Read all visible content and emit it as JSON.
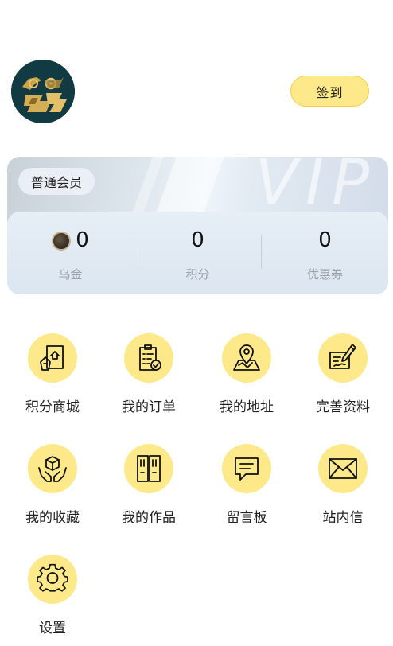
{
  "header": {
    "avatar_icon": "user-avatar-logo",
    "signin_label": "签到"
  },
  "vip_card": {
    "watermark": "VIP",
    "member_level": "普通会员",
    "stats": [
      {
        "value": "0",
        "label": "乌金",
        "icon": "coin-icon"
      },
      {
        "value": "0",
        "label": "积分"
      },
      {
        "value": "0",
        "label": "优惠券"
      }
    ]
  },
  "menu": {
    "items": [
      {
        "label": "积分商城",
        "icon": "points-mall-icon"
      },
      {
        "label": "我的订单",
        "icon": "orders-clipboard-icon"
      },
      {
        "label": "我的地址",
        "icon": "map-pin-icon"
      },
      {
        "label": "完善资料",
        "icon": "edit-profile-icon"
      },
      {
        "label": "我的收藏",
        "icon": "collection-hands-icon"
      },
      {
        "label": "我的作品",
        "icon": "works-book-icon"
      },
      {
        "label": "留言板",
        "icon": "message-board-icon"
      },
      {
        "label": "站内信",
        "icon": "mail-envelope-icon"
      },
      {
        "label": "设置",
        "icon": "gear-icon"
      }
    ]
  },
  "colors": {
    "accent_yellow": "#fde98a",
    "accent_border": "#f2cf43",
    "label_gray": "#9aa1a8"
  }
}
